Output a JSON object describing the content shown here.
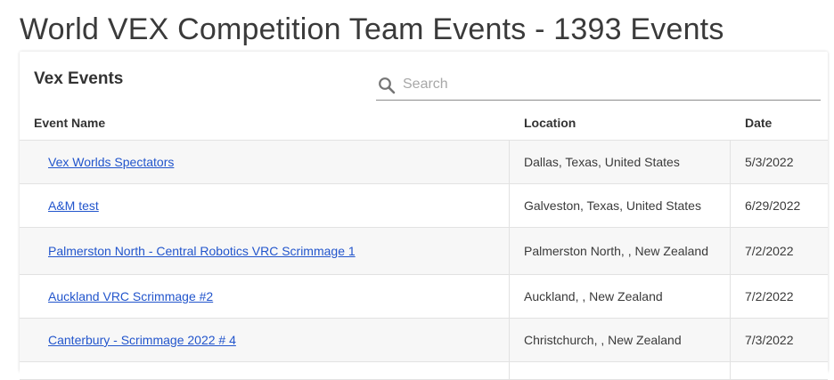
{
  "page": {
    "title": "World VEX Competition Team Events - 1393 Events"
  },
  "card": {
    "title": "Vex Events"
  },
  "search": {
    "placeholder": "Search",
    "value": "",
    "icon": "search-icon"
  },
  "table": {
    "headers": {
      "name": "Event Name",
      "location": "Location",
      "date": "Date"
    },
    "rows": [
      {
        "name": "Vex Worlds Spectators",
        "location": "Dallas, Texas, United States",
        "date": "5/3/2022"
      },
      {
        "name": "A&M test",
        "location": "Galveston, Texas, United States",
        "date": "6/29/2022"
      },
      {
        "name": "Palmerston North - Central Robotics VRC Scrimmage 1",
        "location": "Palmerston North, , New Zealand",
        "date": "7/2/2022"
      },
      {
        "name": "Auckland VRC Scrimmage #2",
        "location": "Auckland, , New Zealand",
        "date": "7/2/2022"
      },
      {
        "name": "Canterbury - Scrimmage 2022 # 4",
        "location": "Christchurch, , New Zealand",
        "date": "7/3/2022"
      },
      {
        "name": "",
        "location": "",
        "date": ""
      }
    ]
  },
  "colors": {
    "link": "#2255cc",
    "text": "#3a3a3a",
    "row_alt": "#f7f7f7",
    "border": "#e2e2e2"
  }
}
